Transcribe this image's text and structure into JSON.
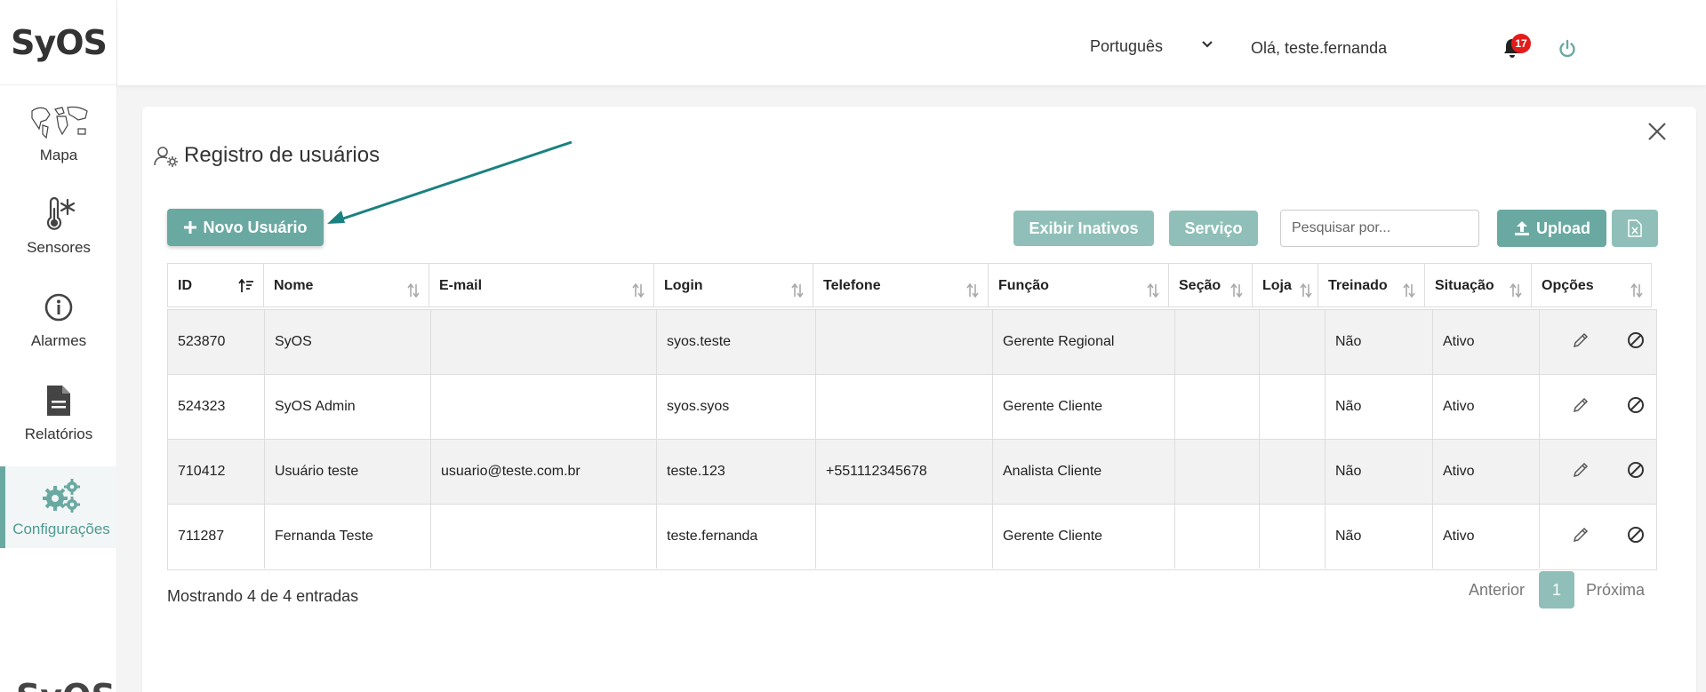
{
  "app": {
    "logo": "SyOS",
    "footer_logo": "SyOS"
  },
  "sidebar": {
    "items": [
      {
        "label": "Mapa",
        "icon": "world-map-icon"
      },
      {
        "label": "Sensores",
        "icon": "thermometer-snowflake-icon"
      },
      {
        "label": "Alarmes",
        "icon": "info-circle-icon"
      },
      {
        "label": "Relatórios",
        "icon": "document-icon"
      },
      {
        "label": "Configurações",
        "icon": "gears-icon",
        "active": true
      }
    ]
  },
  "header": {
    "language": "Português",
    "greeting": "Olá, teste.fernanda",
    "notifications": "17"
  },
  "page": {
    "title": "Registro de usuários",
    "new_user_label": "Novo Usuário",
    "show_inactive_label": "Exibir Inativos",
    "service_label": "Serviço",
    "search_placeholder": "Pesquisar por...",
    "upload_label": "Upload"
  },
  "table": {
    "columns": [
      "ID",
      "Nome",
      "E-mail",
      "Login",
      "Telefone",
      "Função",
      "Seção",
      "Loja",
      "Treinado",
      "Situação",
      "Opções"
    ],
    "rows": [
      {
        "id": "523870",
        "nome": "SyOS",
        "email": "",
        "login": "syos.teste",
        "telefone": "",
        "funcao": "Gerente Regional",
        "secao": "",
        "loja": "",
        "treinado": "Não",
        "situacao": "Ativo"
      },
      {
        "id": "524323",
        "nome": "SyOS Admin",
        "email": "",
        "login": "syos.syos",
        "telefone": "",
        "funcao": "Gerente Cliente",
        "secao": "",
        "loja": "",
        "treinado": "Não",
        "situacao": "Ativo"
      },
      {
        "id": "710412",
        "nome": "Usuário teste",
        "email": "usuario@teste.com.br",
        "login": "teste.123",
        "telefone": "+551112345678",
        "funcao": "Analista Cliente",
        "secao": "",
        "loja": "",
        "treinado": "Não",
        "situacao": "Ativo"
      },
      {
        "id": "711287",
        "nome": "Fernanda Teste",
        "email": "",
        "login": "teste.fernanda",
        "telefone": "",
        "funcao": "Gerente Cliente",
        "secao": "",
        "loja": "",
        "treinado": "Não",
        "situacao": "Ativo"
      }
    ]
  },
  "footer": {
    "showing": "Mostrando 4 de 4 entradas",
    "prev": "Anterior",
    "page": "1",
    "next": "Próxima"
  },
  "colors": {
    "accent": "#6aa9a2",
    "accent_muted": "#8fbfb8",
    "badge": "#e31b1b",
    "arrow": "#1b8180"
  }
}
